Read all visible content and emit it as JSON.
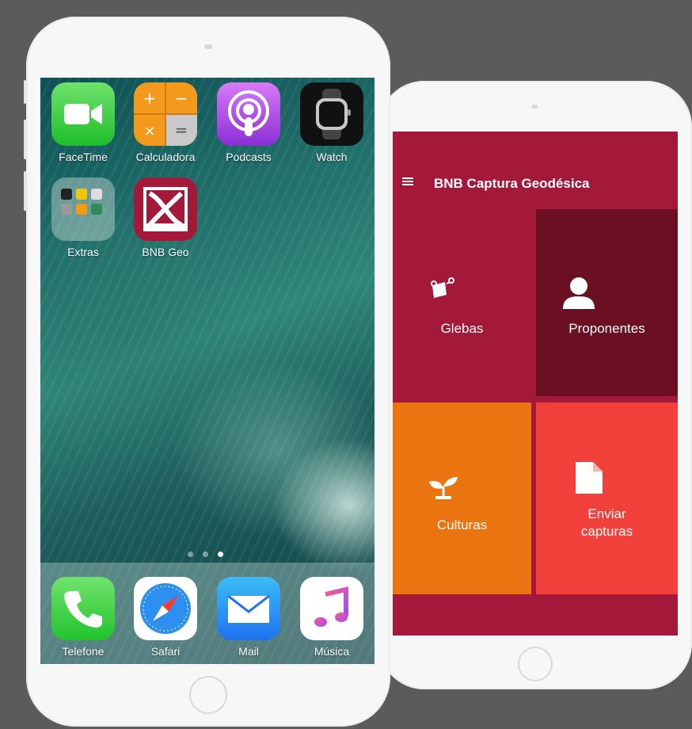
{
  "home_screen": {
    "apps": [
      {
        "label": "FaceTime",
        "icon": "facetime-icon"
      },
      {
        "label": "Calculadora",
        "icon": "calculator-icon"
      },
      {
        "label": "Podcasts",
        "icon": "podcasts-icon"
      },
      {
        "label": "Watch",
        "icon": "watch-icon"
      },
      {
        "label": "Extras",
        "icon": "folder-icon"
      },
      {
        "label": "BNB Geo",
        "icon": "bnb-geo-icon"
      }
    ],
    "dock": [
      {
        "label": "Telefone",
        "icon": "phone-icon"
      },
      {
        "label": "Safari",
        "icon": "safari-icon"
      },
      {
        "label": "Mail",
        "icon": "mail-icon"
      },
      {
        "label": "Música",
        "icon": "music-icon"
      }
    ],
    "page_dots": 3,
    "active_page": 3
  },
  "bnb_app": {
    "title": "BNB Captura Geodésica",
    "menu_icon": "hamburger-menu-icon",
    "tiles": [
      {
        "label": "Glebas",
        "icon": "gps-flag-icon",
        "color": "#a4183a"
      },
      {
        "label": "Proponentes",
        "icon": "person-icon",
        "color": "#6b0f22"
      },
      {
        "label": "Culturas",
        "icon": "sprout-icon",
        "color": "#ec7410"
      },
      {
        "label_line1": "Enviar",
        "label_line2": "capturas",
        "icon": "document-icon",
        "color": "#f2403a"
      }
    ],
    "colors": {
      "primary": "#a4183a",
      "divider": "#ffffff"
    }
  }
}
